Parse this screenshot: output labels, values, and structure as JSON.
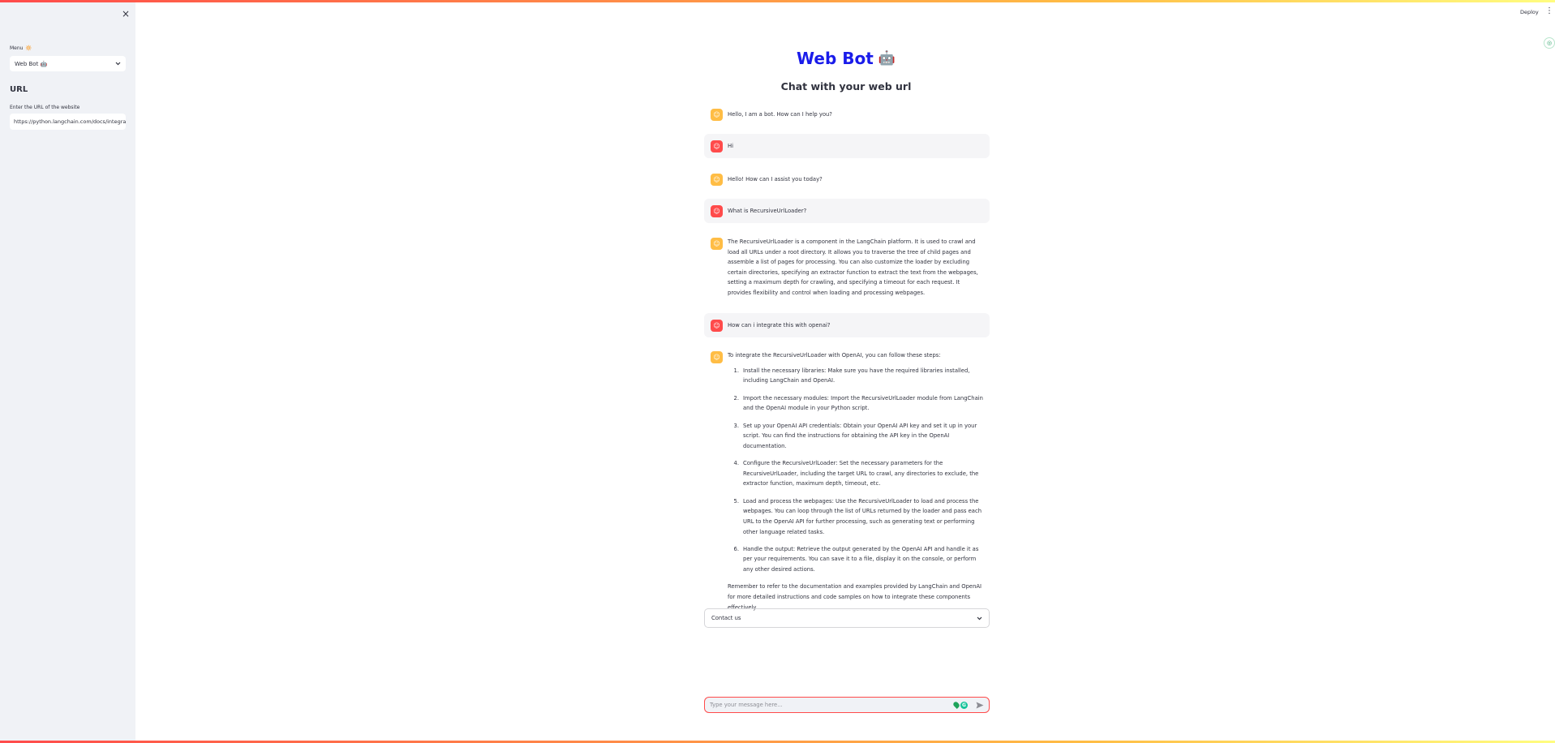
{
  "sidebar": {
    "close_label": "×",
    "menu_label": "Menu",
    "menu_icon": "🔆",
    "menu_selected": "Web Bot 🤖",
    "section_heading": "URL",
    "url_label": "Enter the URL of the website",
    "url_value": "https://python.langchain.com/docs/integrations"
  },
  "header": {
    "deploy_label": "Deploy",
    "menu_icon": "⋮"
  },
  "main": {
    "title": "Web Bot",
    "title_emoji": "🤖",
    "subtitle": "Chat with your web url",
    "messages": [
      {
        "role": "bot",
        "text": "Hello, I am a bot. How can I help you?"
      },
      {
        "role": "user",
        "text": "Hi"
      },
      {
        "role": "bot",
        "text": "Hello! How can I assist you today?"
      },
      {
        "role": "user",
        "text": "What is RecursiveUrlLoader?"
      },
      {
        "role": "bot",
        "text": "The RecursiveUrlLoader is a component in the LangChain platform. It is used to crawl and load all URLs under a root directory. It allows you to traverse the tree of child pages and assemble a list of pages for processing. You can also customize the loader by excluding certain directories, specifying an extractor function to extract the text from the webpages, setting a maximum depth for crawling, and specifying a timeout for each request. It provides flexibility and control when loading and processing webpages."
      },
      {
        "role": "user",
        "text": "How can i integrate this with openai?"
      },
      {
        "role": "bot",
        "intro": "To integrate the RecursiveUrlLoader with OpenAI, you can follow these steps:",
        "steps": [
          "Install the necessary libraries: Make sure you have the required libraries installed, including LangChain and OpenAI.",
          "Import the necessary modules: Import the RecursiveUrlLoader module from LangChain and the OpenAI module in your Python script.",
          "Set up your OpenAI API credentials: Obtain your OpenAI API key and set it up in your script. You can find the instructions for obtaining the API key in the OpenAI documentation.",
          "Configure the RecursiveUrlLoader: Set the necessary parameters for the RecursiveUrlLoader, including the target URL to crawl, any directories to exclude, the extractor function, maximum depth, timeout, etc.",
          "Load and process the webpages: Use the RecursiveUrlLoader to load and process the webpages. You can loop through the list of URLs returned by the loader and pass each URL to the OpenAI API for further processing, such as generating text or performing other language related tasks.",
          "Handle the output: Retrieve the output generated by the OpenAI API and handle it as per your requirements. You can save it to a file, display it on the console, or perform any other desired actions."
        ],
        "step_numbers": [
          "1.",
          "2.",
          "3.",
          "4.",
          "5.",
          "6."
        ],
        "outro": "Remember to refer to the documentation and examples provided by LangChain and OpenAI for more detailed instructions and code samples on how to integrate these components effectively."
      }
    ],
    "expander_label": "Contact us",
    "chat_placeholder": "Type your message here..."
  },
  "colors": {
    "accent": "#ff4b4b",
    "bot_avatar": "#ffbd45",
    "title": "#1a1cea",
    "sidebar_bg": "#f0f2f6"
  }
}
